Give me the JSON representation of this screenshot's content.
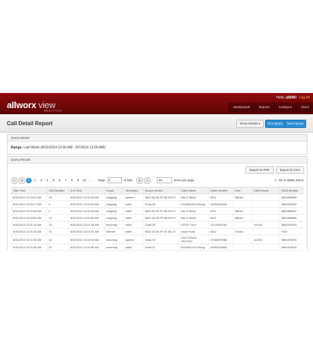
{
  "brand": {
    "name_bold": "allworx",
    "name_light": " view",
    "tagline": "ANALYTICS"
  },
  "user": {
    "greeting": "Hello,",
    "username": "a5546!",
    "logoff": "Log off"
  },
  "nav": [
    "Dashboards",
    "Reports",
    "Configure",
    "About"
  ],
  "page": {
    "title": "Call Detail Report"
  },
  "header_buttons": {
    "show_details": "Show Details ▾",
    "run_query": "Run Query",
    "save_query": "Save Query"
  },
  "query_details": {
    "title": "Query Details",
    "range_label": "Range:",
    "range_value": "Last Week (8/31/2014 12:00 AM - 9/7/2014 12:00 AM)"
  },
  "results": {
    "title": "Query Results",
    "export_pdf": "Export To PDF",
    "export_csv": "Export To CSV",
    "pager": {
      "first": "«",
      "prev": "◂",
      "pages": [
        "1",
        "2",
        "3",
        "4",
        "5",
        "6",
        "7",
        "8",
        "9",
        "10",
        "..."
      ],
      "page_label": "Page",
      "page_value": "1",
      "of_label": "of 938",
      "next": "▸",
      "last": "»",
      "page_size": "50",
      "per_page_label": "items per page",
      "info": "1 - 50 of 46881 items"
    },
    "columns": [
      "Start Time",
      "Call Duration",
      "End Time",
      "Scope",
      "Terminator",
      "Source Device",
      "Caller Name",
      "Caller Number",
      "User",
      "DNIS Name",
      "DNIS Number"
    ],
    "rows": [
      [
        "8/31/2014 12:00:02 AM",
        "15",
        "8/31/2014 12:00:18 AM",
        "outgoing",
        "system",
        "MAC:00-0E-FF-85-E5-FC",
        "Ben D Brine",
        "5011",
        "BBrine",
        "",
        "5854368669"
      ],
      [
        "8/31/2014 12:00:17 AM",
        "8",
        "8/31/2014 12:00:25 AM",
        "outgoing",
        "caller",
        "Chan:36",
        "EGAWUGIS Wrong",
        "16052430646",
        "",
        "",
        "5854315539"
      ],
      [
        "8/31/2014 12:00:38 AM",
        "0",
        "8/31/2014 12:00:38 AM",
        "outgoing",
        "caller",
        "MAC:00-0E-FF-85-E5-FC",
        "Ben D Brine",
        "5011",
        "BBrine",
        "",
        "5854368667"
      ],
      [
        "8/31/2014 12:00:50 AM",
        "12",
        "8/31/2014 12:00:59 AM",
        "outgoing",
        "caller",
        "MAC:00-0E-FF-85-E5-FC",
        "Ben D Brine",
        "5011",
        "BBrine",
        "",
        "5854368669"
      ],
      [
        "8/31/2014 12:01:15 AM",
        "23",
        "8/31/2014 12:01:38 AM",
        "incoming",
        "caller",
        "Chan:36",
        "EZZSY Tech",
        "13142653150",
        "",
        "na DID",
        "5854315500"
      ],
      [
        "8/31/2014 12:01:20 AM",
        "31",
        "8/31/2014 12:01:51 AM",
        "internal",
        "caller",
        "MAC:00-0E-FF-87-BC-57",
        "David Husk",
        "5042",
        "DHusk",
        "",
        "*404"
      ],
      [
        "8/31/2014 12:01:32 AM",
        "32",
        "8/31/2014 12:02:04 AM",
        "incoming",
        "system",
        "Chan:33",
        "UNCTODKH VIVLTQC",
        "17066397468",
        "",
        "na DID",
        "5854315500"
      ],
      [
        "8/31/2014 12:01:36 AM",
        "20",
        "8/31/2014 12:01:56 AM",
        "incoming",
        "caller",
        "Chan:31",
        "EGAWUGIS Wrong",
        "16052430646",
        "",
        "",
        "5854315539"
      ]
    ]
  }
}
